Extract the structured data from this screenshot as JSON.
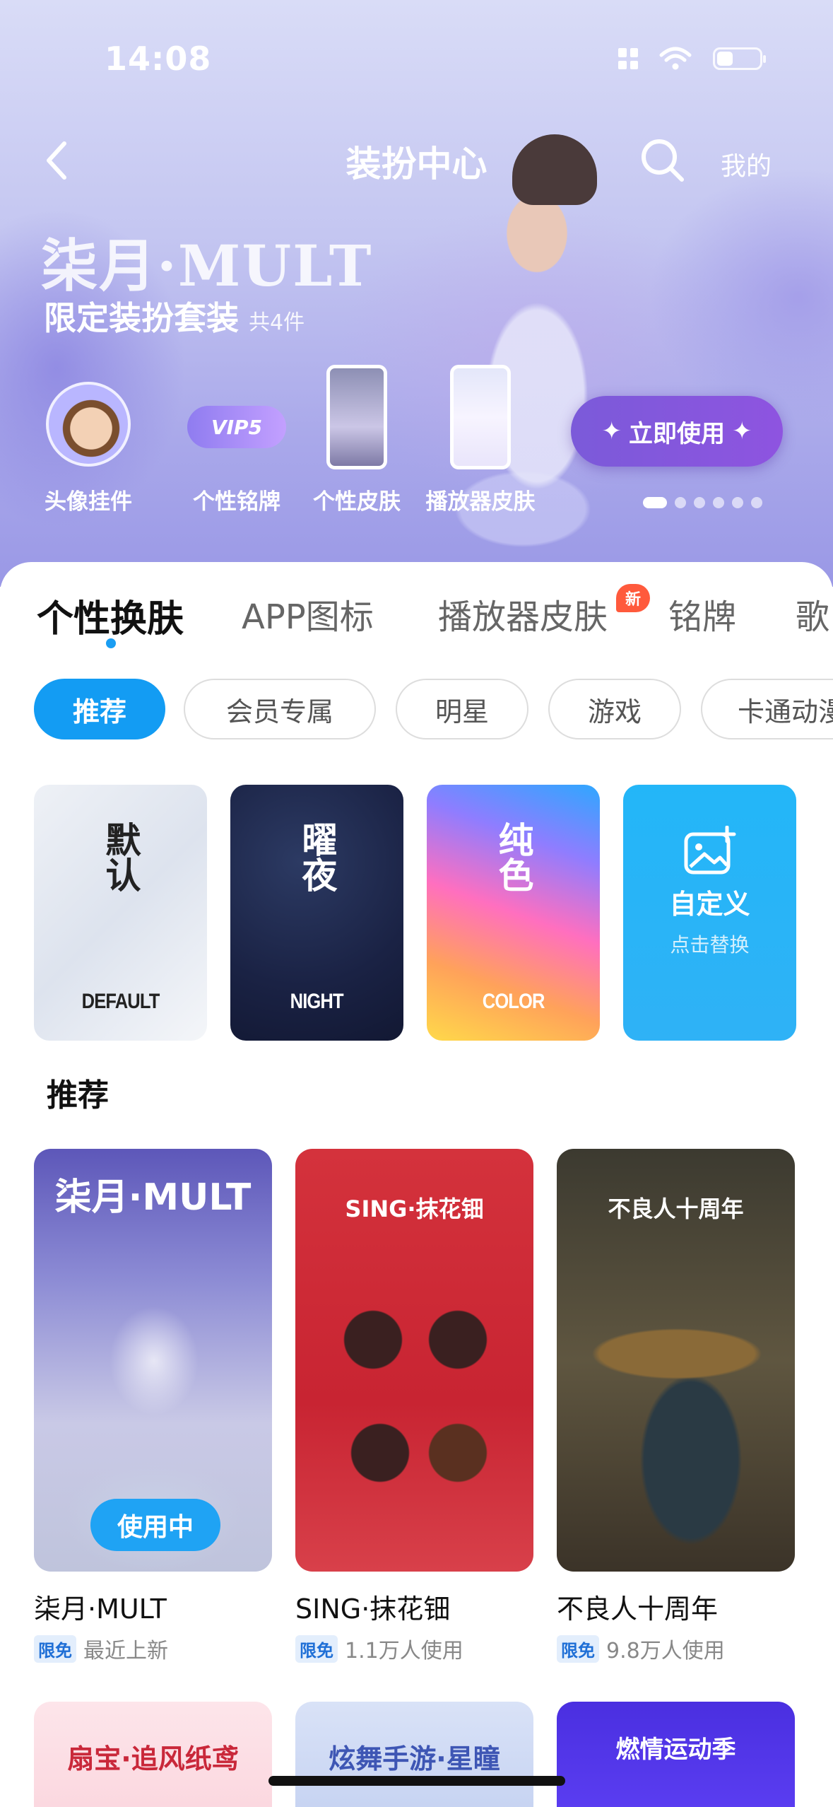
{
  "status": {
    "time": "14:08"
  },
  "nav": {
    "title": "装扮中心",
    "mine": "我的"
  },
  "hero": {
    "logo": "柒月·MULT",
    "subtitle": "限定装扮套装",
    "count": "共4件",
    "items": [
      {
        "label": "头像挂件"
      },
      {
        "label": "个性铭牌",
        "badge_text": "VIP5"
      },
      {
        "label": "个性皮肤"
      },
      {
        "label": "播放器皮肤"
      }
    ],
    "cta": "立即使用",
    "carousel_pages": 6,
    "carousel_active": 1
  },
  "tabs": [
    {
      "label": "个性换肤",
      "active": true
    },
    {
      "label": "APP图标"
    },
    {
      "label": "播放器皮肤",
      "badge": "新"
    },
    {
      "label": "铭牌"
    },
    {
      "label": "歌"
    }
  ],
  "chips": [
    {
      "label": "推荐",
      "active": true
    },
    {
      "label": "会员专属"
    },
    {
      "label": "明星"
    },
    {
      "label": "游戏"
    },
    {
      "label": "卡通动漫"
    }
  ],
  "themes": [
    {
      "label": "默认",
      "en": "DEFAULT"
    },
    {
      "label": "曜夜",
      "en": "NIGHT"
    },
    {
      "label": "纯色",
      "en": "COLOR"
    },
    {
      "label": "自定义",
      "hint": "点击替换"
    }
  ],
  "section": {
    "title": "推荐"
  },
  "cards": [
    {
      "image_title": "柒月·MULT",
      "name": "柒月·MULT",
      "tag": "限免",
      "meta": "最近上新",
      "in_use": "使用中"
    },
    {
      "image_title": "SING·抹花钿",
      "name": "SING·抹花钿",
      "tag": "限免",
      "meta": "1.1万人使用"
    },
    {
      "image_title": "不良人十周年",
      "name": "不良人十周年",
      "tag": "限免",
      "meta": "9.8万人使用"
    }
  ],
  "cards_next": [
    {
      "image_title": "扇宝·追风纸鸢"
    },
    {
      "image_title": "炫舞手游·星瞳"
    },
    {
      "image_title": "燃情运动季"
    }
  ],
  "colors": {
    "accent": "#139cf3",
    "cta": "#7b5ad9",
    "badge": "#ff5a3c"
  }
}
